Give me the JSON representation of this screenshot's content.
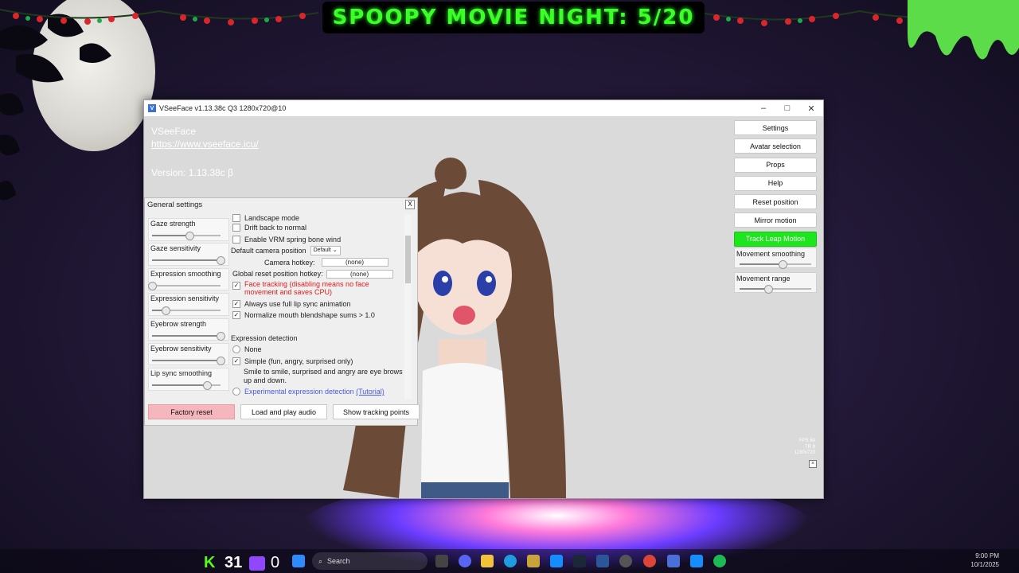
{
  "background": {
    "banner_text": "SPOOPY MOVIE NIGHT: 5/20"
  },
  "window": {
    "title": "VSeeFace v1.13.38c Q3 1280x720@10",
    "app_name": "VSeeFace",
    "url": "https://www.vseeface.icu/",
    "version": "Version: 1.13.38c β",
    "controls": {
      "minimize": "–",
      "maximize": "□",
      "close": "✕"
    }
  },
  "right_menu": {
    "buttons": [
      "Settings",
      "Avatar selection",
      "Props",
      "Help",
      "Reset position",
      "Mirror motion",
      "Track Leap Motion"
    ],
    "active_color": "#1fe51f",
    "sliders": [
      {
        "label": "Movement smoothing",
        "value": 0.6
      },
      {
        "label": "Movement range",
        "value": 0.4
      }
    ]
  },
  "stats": {
    "fps": "FPS 60",
    "tr": "TR   9",
    "res": "1280x720"
  },
  "dialog": {
    "title": "General settings",
    "close_label": "X",
    "left_sliders": [
      {
        "label": "Gaze strength",
        "value": 0.55
      },
      {
        "label": "Gaze sensitivity",
        "value": 1.0
      },
      {
        "label": "Expression smoothing",
        "value": 0.0
      },
      {
        "label": "Expression sensitivity",
        "value": 0.2
      },
      {
        "label": "Eyebrow strength",
        "value": 1.0
      },
      {
        "label": "Eyebrow sensitivity",
        "value": 1.0
      },
      {
        "label": "Lip sync smoothing",
        "value": 0.8
      }
    ],
    "options": {
      "landscape": "Landscape mode",
      "drift": "Drift back to normal",
      "spring": "Enable VRM spring bone wind",
      "camera_position_label": "Default camera position",
      "camera_position_value": "Default",
      "camera_hotkey_label": "Camera hotkey:",
      "camera_hotkey_value": "(none)",
      "reset_hotkey_label": "Global reset position hotkey:",
      "reset_hotkey_value": "(none)",
      "face_tracking": "Face tracking (disabling means no face movement and saves CPU)",
      "lip_sync": "Always use full lip sync animation",
      "normalize": "Normalize mouth blendshape sums > 1.0",
      "expression_detection": "Expression detection",
      "none": "None",
      "simple": "Simple (fun, angry, surprised only)",
      "simple_desc": "Smile to smile, surprised and angry are eye brows up and down.",
      "experimental": "Experimental expression detection",
      "tutorial": "(Tutorial)"
    },
    "buttons": {
      "factory_reset": "Factory reset",
      "load_audio": "Load and play audio",
      "show_tracking": "Show tracking points"
    }
  },
  "taskbar": {
    "kick_count": "31",
    "twitch_count": "0",
    "search_placeholder": "Search",
    "time": "9:00 PM",
    "date": "10/1/2025"
  }
}
